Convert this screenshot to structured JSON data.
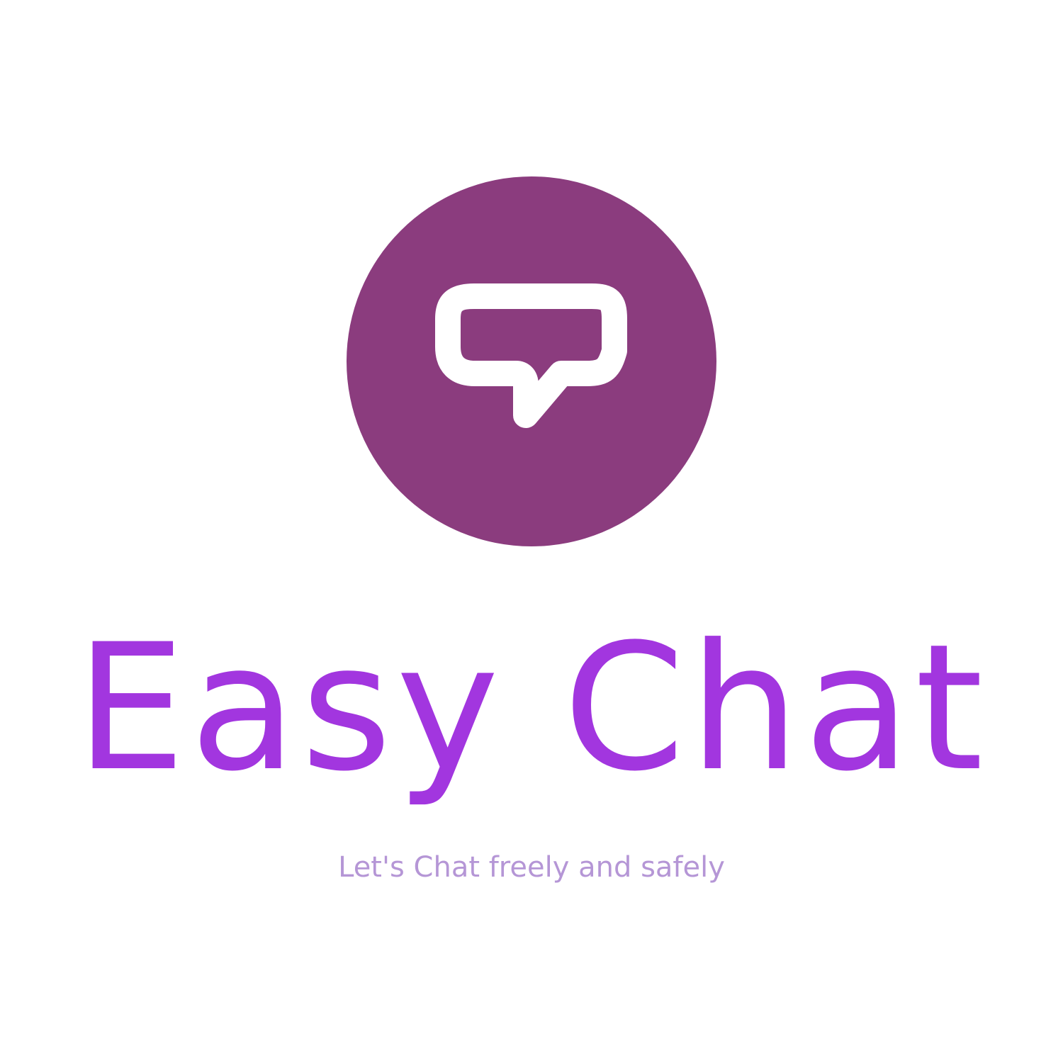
{
  "brand": {
    "name": "Easy Chat",
    "tagline": "Let's Chat freely and safely"
  },
  "logo": {
    "icon": "speech-bubble-icon"
  },
  "colors": {
    "background": "#ffffff",
    "circle": "#8b3c7e",
    "icon": "#ffffff",
    "brand_name": "#a236df",
    "tagline": "#b596d6"
  }
}
